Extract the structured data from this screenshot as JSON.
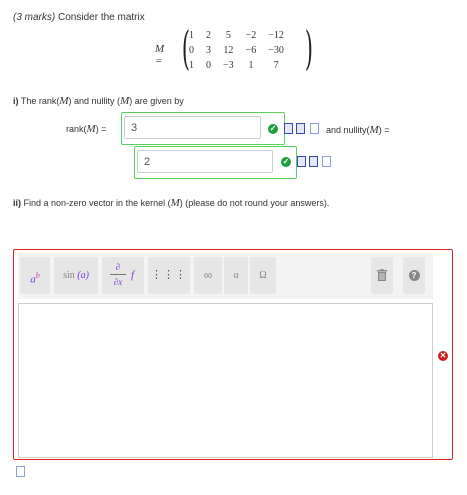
{
  "question": {
    "marks": "(3 marks)",
    "prompt": "Consider the matrix",
    "matrix_symbol": "M =",
    "matrix": [
      [
        "1",
        "2",
        "5",
        "−2",
        "−12"
      ],
      [
        "0",
        "3",
        "12",
        "−6",
        "−30"
      ],
      [
        "1",
        "0",
        "−3",
        "1",
        "7"
      ]
    ]
  },
  "part_i": {
    "number": "i)",
    "text_a": "The rank(",
    "m1": "M",
    "text_b": ") and nullity (",
    "m2": "M",
    "text_c": ") are given by",
    "rank_label_a": "rank(",
    "rank_m": "M",
    "rank_label_b": ") =",
    "rank_value": "3",
    "nullity_label_a": "and nullity(",
    "nullity_m": "M",
    "nullity_label_b": ") =",
    "nullity_value": "2",
    "check_glyph": "✓"
  },
  "part_ii": {
    "number": "ii)",
    "text_a": "Find a non-zero vector in the kernel (",
    "m": "M",
    "text_b": ") (please do not round your answers)."
  },
  "toolbar": {
    "superscript": {
      "base": "a",
      "exp": "b"
    },
    "function": {
      "name": "sin",
      "arg": "(a)"
    },
    "calculus": {
      "top": "∂",
      "bottom": "∂x",
      "f": "f"
    },
    "matrix_glyph": "⋮⋮⋮",
    "infinity": "∞",
    "alpha": "α",
    "omega": "Ω",
    "help": "?"
  },
  "error_glyph": "✕",
  "colors": {
    "correct_border": "#5bcf5b",
    "correct_check": "#1e9e3b",
    "error_border": "#dd2222",
    "accent_purple": "#b03ad6"
  }
}
